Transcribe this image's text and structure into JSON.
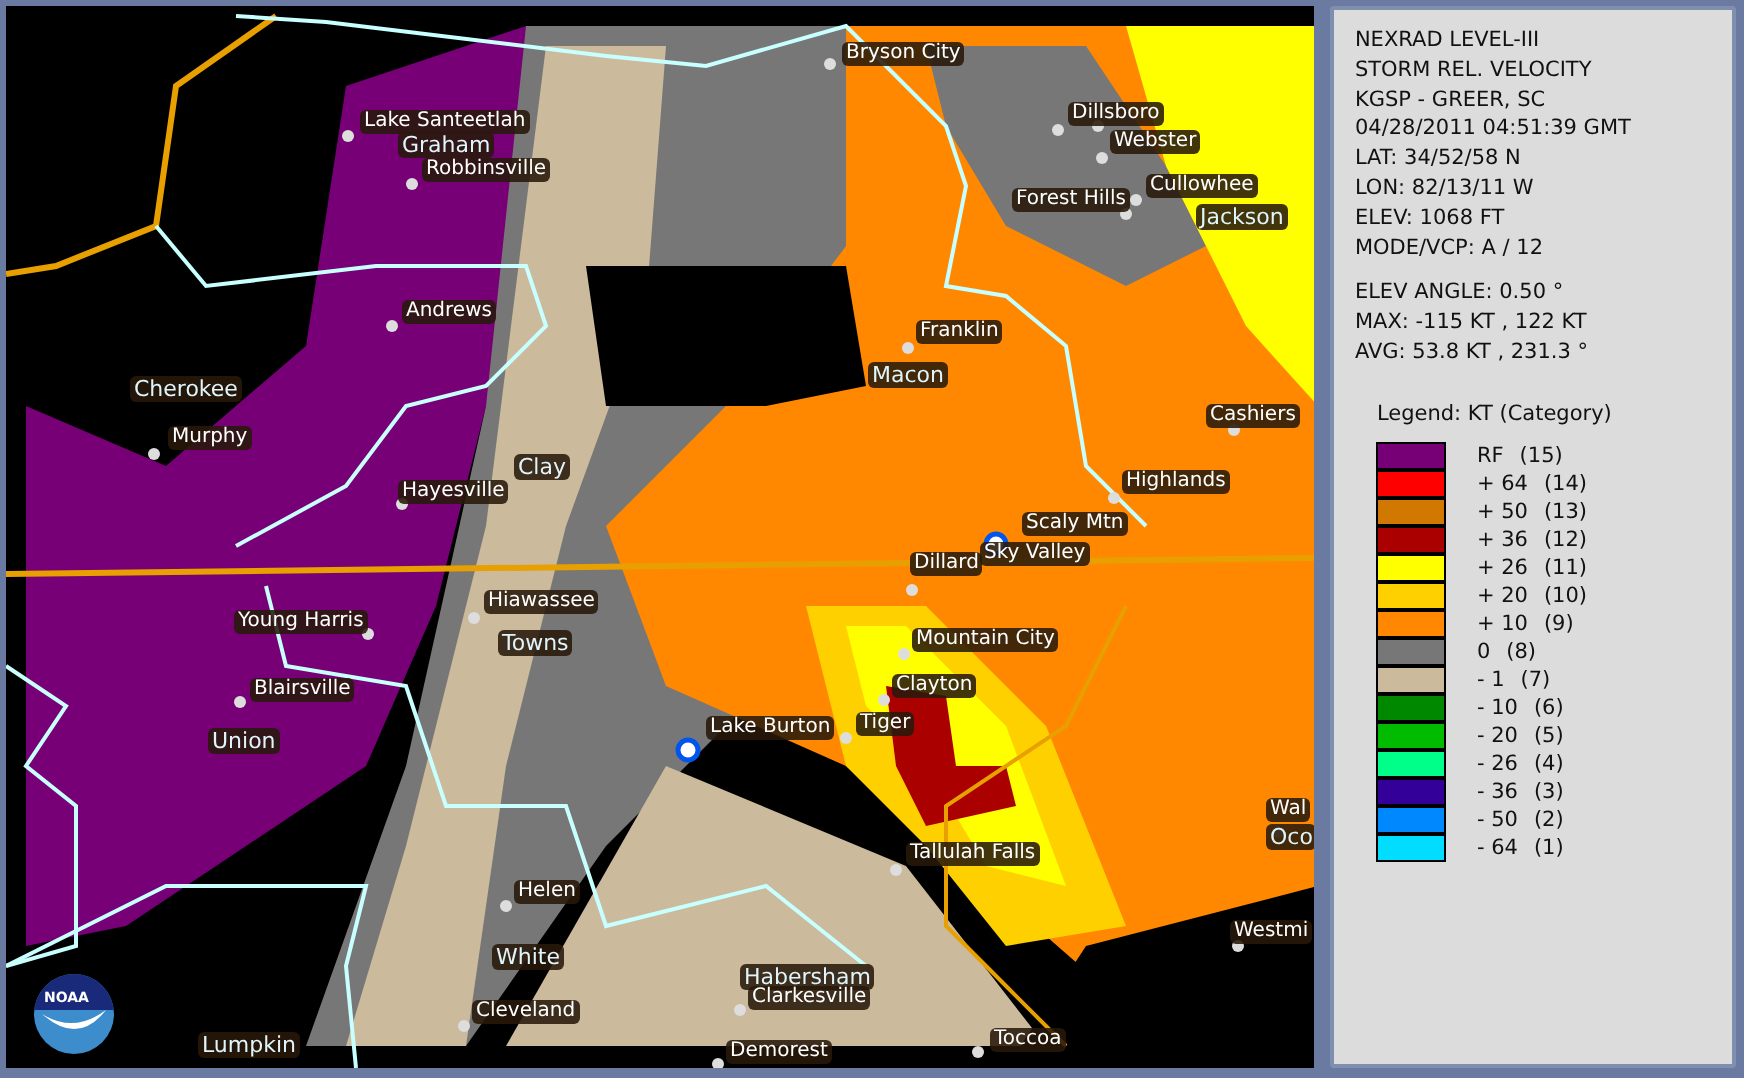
{
  "map": {
    "labels": [
      {
        "text": "Bryson City",
        "kind": "town"
      },
      {
        "text": "Lake Santeetlah",
        "kind": "town"
      },
      {
        "text": "Graham",
        "kind": "county"
      },
      {
        "text": "Robbinsville",
        "kind": "town"
      },
      {
        "text": "Dillsboro",
        "kind": "town"
      },
      {
        "text": "Webster",
        "kind": "town"
      },
      {
        "text": "Cullowhee",
        "kind": "town"
      },
      {
        "text": "Forest Hills",
        "kind": "town"
      },
      {
        "text": "Jackson",
        "kind": "county"
      },
      {
        "text": "Andrews",
        "kind": "town"
      },
      {
        "text": "Franklin",
        "kind": "town"
      },
      {
        "text": "Macon",
        "kind": "county"
      },
      {
        "text": "Cherokee",
        "kind": "county"
      },
      {
        "text": "Murphy",
        "kind": "town"
      },
      {
        "text": "Cashiers",
        "kind": "town"
      },
      {
        "text": "Hayesville",
        "kind": "town"
      },
      {
        "text": "Clay",
        "kind": "county"
      },
      {
        "text": "Highlands",
        "kind": "town"
      },
      {
        "text": "Scaly Mtn",
        "kind": "town"
      },
      {
        "text": "Dillard",
        "kind": "town"
      },
      {
        "text": "Sky Valley",
        "kind": "town"
      },
      {
        "text": "Hiawassee",
        "kind": "town"
      },
      {
        "text": "Young Harris",
        "kind": "town"
      },
      {
        "text": "Towns",
        "kind": "county"
      },
      {
        "text": "Mountain City",
        "kind": "town"
      },
      {
        "text": "Blairsville",
        "kind": "town"
      },
      {
        "text": "Clayton",
        "kind": "town"
      },
      {
        "text": "Lake Burton",
        "kind": "town"
      },
      {
        "text": "Union",
        "kind": "county"
      },
      {
        "text": "Tiger",
        "kind": "town"
      },
      {
        "text": "Tallulah Falls",
        "kind": "town"
      },
      {
        "text": "Wal",
        "kind": "town"
      },
      {
        "text": "Oco",
        "kind": "county"
      },
      {
        "text": "Helen",
        "kind": "town"
      },
      {
        "text": "White",
        "kind": "county"
      },
      {
        "text": "Westmi",
        "kind": "town"
      },
      {
        "text": "Cleveland",
        "kind": "town"
      },
      {
        "text": "Habersham",
        "kind": "county"
      },
      {
        "text": "Clarkesville",
        "kind": "town"
      },
      {
        "text": "Lumpkin",
        "kind": "county"
      },
      {
        "text": "Demorest",
        "kind": "town"
      },
      {
        "text": "Toccoa",
        "kind": "town"
      }
    ],
    "logo_text": "NOAA"
  },
  "info": {
    "header": [
      "NEXRAD LEVEL-III",
      "STORM REL. VELOCITY",
      "KGSP - GREER, SC",
      "04/28/2011 04:51:39 GMT",
      "LAT: 34/52/58 N",
      "LON: 82/13/11 W",
      "ELEV: 1068 FT",
      "MODE/VCP: A / 12"
    ],
    "stats": [
      "ELEV ANGLE: 0.50 °",
      "MAX: -115 KT , 122 KT",
      "AVG: 53.8 KT , 231.3 °"
    ]
  },
  "legend": {
    "title": "Legend: KT (Category)",
    "items": [
      {
        "value": "RF",
        "category": "(15)",
        "color": "#770077"
      },
      {
        "value": "+ 64",
        "category": "(14)",
        "color": "#ff0000"
      },
      {
        "value": "+ 50",
        "category": "(13)",
        "color": "#d07800"
      },
      {
        "value": "+ 36",
        "category": "(12)",
        "color": "#aa0000"
      },
      {
        "value": "+ 26",
        "category": "(11)",
        "color": "#ffff00"
      },
      {
        "value": "+ 20",
        "category": "(10)",
        "color": "#ffd000"
      },
      {
        "value": "+ 10",
        "category": "(9)",
        "color": "#ff8800"
      },
      {
        "value": "0",
        "category": "(8)",
        "color": "#777777"
      },
      {
        "value": "- 1",
        "category": "(7)",
        "color": "#cbbb9c"
      },
      {
        "value": "- 10",
        "category": "(6)",
        "color": "#008800"
      },
      {
        "value": "- 20",
        "category": "(5)",
        "color": "#00bb00"
      },
      {
        "value": "- 26",
        "category": "(4)",
        "color": "#00ff88"
      },
      {
        "value": "- 36",
        "category": "(3)",
        "color": "#330099"
      },
      {
        "value": "- 50",
        "category": "(2)",
        "color": "#0088ff"
      },
      {
        "value": "- 64",
        "category": "(1)",
        "color": "#00ddff"
      }
    ]
  }
}
